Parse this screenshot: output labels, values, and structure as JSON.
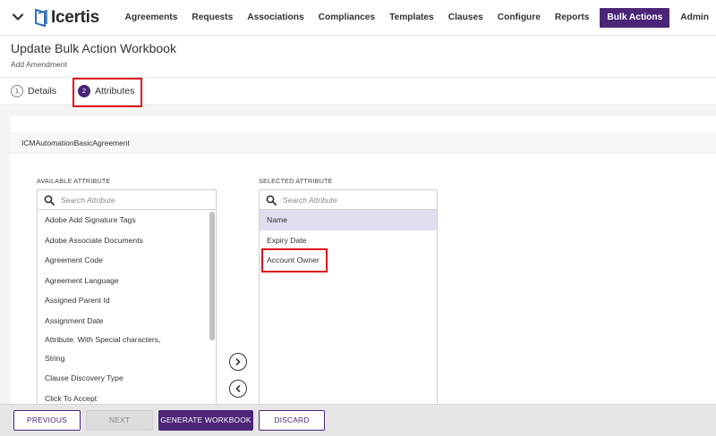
{
  "app": {
    "brand": "Icertis"
  },
  "nav": {
    "items": [
      "Agreements",
      "Requests",
      "Associations",
      "Compliances",
      "Templates",
      "Clauses",
      "Configure",
      "Reports",
      "Bulk Actions",
      "Admin"
    ],
    "active": "Bulk Actions"
  },
  "page": {
    "title": "Update Bulk Action Workbook",
    "subtitle": "Add Amendment"
  },
  "steps": [
    {
      "num": "1",
      "label": "Details"
    },
    {
      "num": "2",
      "label": "Attributes"
    }
  ],
  "agreement": {
    "name": "ICMAutomationBasicAgreement"
  },
  "available": {
    "label": "AVAILABLE ATTRIBUTE",
    "search_placeholder": "Search Attribute",
    "items": [
      "Adobe Add Signature Tags",
      "Adobe Associate Documents",
      "Agreement Code",
      "Agreement Language",
      "Assigned Parent Id",
      "Assignment Date",
      "Attribute. With Special characters, String",
      "Clause Discovery Type",
      "Click To Accept"
    ]
  },
  "selected": {
    "label": "SELECTED ATTRIBUTE",
    "search_placeholder": "Search Attribute",
    "items": [
      "Name",
      "Expiry Date",
      "Account Owner"
    ]
  },
  "footer": {
    "previous": "PREVIOUS",
    "next": "NEXT",
    "generate": "GENERATE WORKBOOK",
    "discard": "DISCARD"
  },
  "colors": {
    "brand_purple": "#4b2678",
    "highlight_red": "#e0101a",
    "selected_row": "#e3dcee"
  },
  "icons": [
    "chevron-down-icon",
    "icertis-logo-icon",
    "search-icon",
    "arrow-right-icon",
    "arrow-left-icon"
  ]
}
